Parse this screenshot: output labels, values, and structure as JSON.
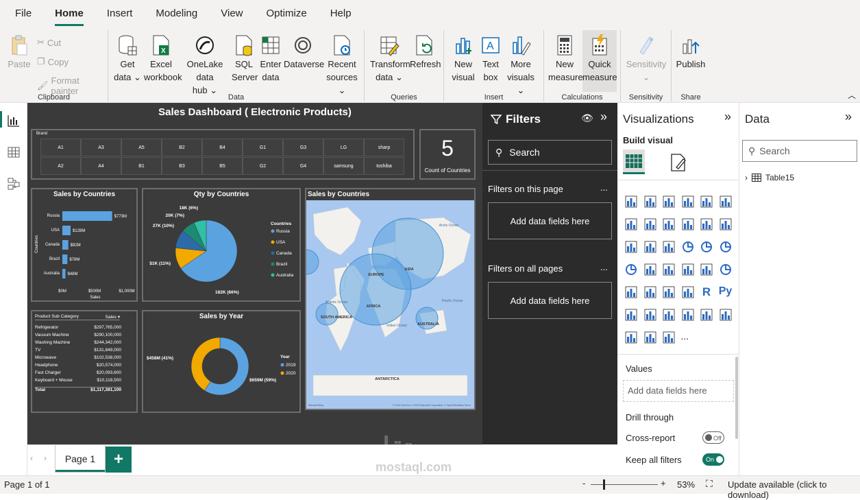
{
  "menu": {
    "file": "File",
    "home": "Home",
    "insert": "Insert",
    "modeling": "Modeling",
    "view": "View",
    "optimize": "Optimize",
    "help": "Help"
  },
  "ribbon": {
    "clipboard": {
      "paste": "Paste",
      "cut": "Cut",
      "copy": "Copy",
      "format_painter": "Format painter",
      "label": "Clipboard"
    },
    "data": {
      "get_data": [
        "Get",
        "data"
      ],
      "excel": [
        "Excel",
        "workbook"
      ],
      "onelake": [
        "OneLake data",
        "hub"
      ],
      "sql": [
        "SQL",
        "Server"
      ],
      "enter": [
        "Enter",
        "data"
      ],
      "dataverse": [
        "Dataverse",
        ""
      ],
      "recent": [
        "Recent",
        "sources"
      ],
      "label": "Data"
    },
    "queries": {
      "transform": [
        "Transform",
        "data"
      ],
      "refresh": [
        "Refresh",
        ""
      ],
      "label": "Queries"
    },
    "insert": {
      "new_visual": [
        "New",
        "visual"
      ],
      "text_box": [
        "Text",
        "box"
      ],
      "more_visuals": [
        "More",
        "visuals"
      ],
      "label": "Insert"
    },
    "calculations": {
      "new_measure": [
        "New",
        "measure"
      ],
      "quick_measure": [
        "Quick",
        "measure"
      ],
      "label": "Calculations"
    },
    "sensitivity": {
      "btn": [
        "Sensitivity",
        ""
      ],
      "label": "Sensitivity"
    },
    "share": {
      "publish": [
        "Publish",
        ""
      ],
      "label": "Share"
    }
  },
  "dashboard": {
    "title": "Sales Dashboard ( Electronic Products)",
    "brand_slicer": {
      "label": "Brand",
      "row1": [
        "A1",
        "A3",
        "A5",
        "B2",
        "B4",
        "G1",
        "G3",
        "LG",
        "sharp"
      ],
      "row2": [
        "A2",
        "A4",
        "B1",
        "B3",
        "B5",
        "G2",
        "G4",
        "samsung",
        "toshiba"
      ]
    },
    "card": {
      "value": "5",
      "label": "Count of Countries"
    },
    "table": {
      "headers": [
        "Product Sub Category",
        "Sales"
      ],
      "rows": [
        [
          "Refrigerator",
          "$297,765,000"
        ],
        [
          "Vacuum Machine",
          "$290,100,000"
        ],
        [
          "Washing Machine",
          "$244,342,000"
        ],
        [
          "TV",
          "$131,849,000"
        ],
        [
          "Microwave",
          "$102,538,000"
        ],
        [
          "Headphone",
          "$20,574,000"
        ],
        [
          "Fast Charger",
          "$20,093,600"
        ],
        [
          "Keyboard + Mouse",
          "$10,118,500"
        ]
      ],
      "total": [
        "Total",
        "$1,117,381,100"
      ]
    },
    "map": {
      "title": "Sales by Countries",
      "labels": [
        "EUROPE",
        "ASIA",
        "AFRICA",
        "SOUTH AMERICA",
        "AUSTRALIA",
        "ANTARCTICA",
        "Arctic Ocean",
        "Atlantic Ocean",
        "Pacific Ocean",
        "Indian Ocean"
      ],
      "attribution": "© 2024 TomTom, © 2025 Microsoft Corporation, © OpenStreetMap  Terms",
      "bing": "Microsoft Bing"
    }
  },
  "chart_data": [
    {
      "type": "bar",
      "title": "Sales by Countries",
      "categories": [
        "Russia",
        "USA",
        "Canada",
        "Brazil",
        "Australia"
      ],
      "values": [
        773,
        128,
        92,
        78,
        48
      ],
      "data_labels": [
        "$773M",
        "$128M",
        "$92M",
        "$78M",
        "$48M"
      ],
      "xlabel": "Sales",
      "ylabel": "Countries",
      "xlim": [
        0,
        1000
      ],
      "xticks": [
        "$0M",
        "$500M",
        "$1,000M"
      ]
    },
    {
      "type": "pie",
      "title": "Qty by Countries",
      "legend_title": "Countries",
      "categories": [
        "Russia",
        "USA",
        "Canada",
        "Brazil",
        "Australia"
      ],
      "values": [
        182,
        31,
        27,
        20,
        18
      ],
      "data_labels": [
        "182K (66%)",
        "$1K (11%)",
        "27K (10%)",
        "20K (7%)",
        "18K (6%)"
      ],
      "colors": [
        "#5ba3e0",
        "#f2a900",
        "#2c6aa9",
        "#1d8a74",
        "#2fc0a5"
      ],
      "legend": "right"
    },
    {
      "type": "pie",
      "title": "Sales by Year",
      "legend_title": "Year",
      "categories": [
        "2019",
        "2020"
      ],
      "values": [
        659,
        458
      ],
      "data_labels": [
        "$659M (59%)",
        "$458M (41%)"
      ],
      "colors": [
        "#5ba3e0",
        "#f2a900"
      ],
      "legend": "right"
    }
  ],
  "pages": {
    "tab": "Page 1",
    "add": "+"
  },
  "status": {
    "page": "Page 1 of 1",
    "zoom": "53%",
    "update": "Update available (click to download)"
  },
  "filters": {
    "title": "Filters",
    "search": "Search",
    "on_page": "Filters on this page",
    "on_all": "Filters on all pages",
    "add": "Add data fields here",
    "more": "..."
  },
  "viz": {
    "title": "Visualizations",
    "build": "Build visual",
    "values": "Values",
    "add": "Add data fields here",
    "drill": "Drill through",
    "cross": "Cross-report",
    "keep": "Keep all filters",
    "off": "Off",
    "on": "On",
    "more": "..."
  },
  "data": {
    "title": "Data",
    "search": "Search",
    "table": "Table15"
  },
  "watermark": {
    "arabic": "مستقل",
    "latin": "mostaql.com"
  }
}
